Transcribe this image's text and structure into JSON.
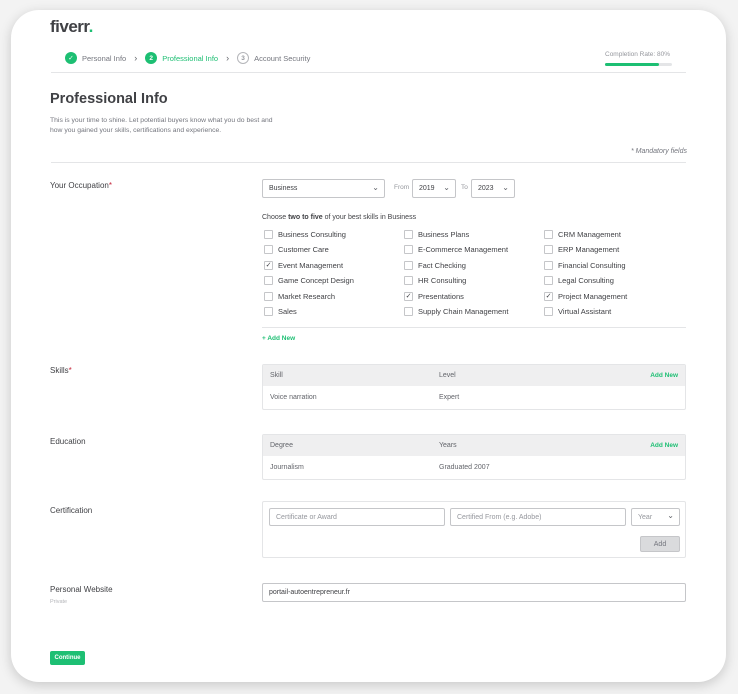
{
  "brand": {
    "logo_text": "fiverr",
    "accent": "#1dbf73"
  },
  "steps": [
    {
      "number": "✓",
      "label": "Personal Info",
      "state": "done"
    },
    {
      "number": "2",
      "label": "Professional Info",
      "state": "active"
    },
    {
      "number": "3",
      "label": "Account Security",
      "state": "todo"
    }
  ],
  "completion": {
    "label": "Completion Rate: 80%",
    "value": 80
  },
  "page": {
    "title": "Professional Info",
    "intro": "This is your time to shine. Let potential buyers know what you do best and how you gained your skills, certifications and experience.",
    "mandatory_note": "* Mandatory fields"
  },
  "occupation": {
    "label": "Your Occupation",
    "required_mark": "*",
    "category": "Business",
    "from_label": "From",
    "from_year": "2019",
    "to_label": "To",
    "to_year": "2023",
    "choose_pre": "Choose ",
    "choose_bold": "two to five",
    "choose_post": " of your best skills in Business",
    "skills": [
      {
        "label": "Business Consulting",
        "checked": false
      },
      {
        "label": "Business Plans",
        "checked": false
      },
      {
        "label": "CRM Management",
        "checked": false
      },
      {
        "label": "Customer Care",
        "checked": false
      },
      {
        "label": "E-Commerce Management",
        "checked": false
      },
      {
        "label": "ERP Management",
        "checked": false
      },
      {
        "label": "Event Management",
        "checked": true
      },
      {
        "label": "Fact Checking",
        "checked": false
      },
      {
        "label": "Financial Consulting",
        "checked": false
      },
      {
        "label": "Game Concept Design",
        "checked": false
      },
      {
        "label": "HR Consulting",
        "checked": false
      },
      {
        "label": "Legal Consulting",
        "checked": false
      },
      {
        "label": "Market Research",
        "checked": false
      },
      {
        "label": "Presentations",
        "checked": true
      },
      {
        "label": "Project Management",
        "checked": true
      },
      {
        "label": "Sales",
        "checked": false
      },
      {
        "label": "Supply Chain Management",
        "checked": false
      },
      {
        "label": "Virtual Assistant",
        "checked": false
      }
    ],
    "add_new": "+ Add New"
  },
  "skills": {
    "label": "Skills",
    "required_mark": "*",
    "headers": {
      "col1": "Skill",
      "col2": "Level",
      "add": "Add New"
    },
    "rows": [
      {
        "col1": "Voice narration",
        "col2": "Expert"
      }
    ]
  },
  "education": {
    "label": "Education",
    "headers": {
      "col1": "Degree",
      "col2": "Years",
      "add": "Add New"
    },
    "rows": [
      {
        "col1": "Journalism",
        "col2": "Graduated 2007"
      }
    ]
  },
  "certification": {
    "label": "Certification",
    "name_placeholder": "Certificate or Award",
    "from_placeholder": "Certified From (e.g. Adobe)",
    "year_placeholder": "Year",
    "add_button": "Add"
  },
  "website": {
    "label": "Personal Website",
    "sub_label": "Private",
    "value": "portail-autoentrepreneur.fr"
  },
  "footer": {
    "continue": "Continue"
  }
}
